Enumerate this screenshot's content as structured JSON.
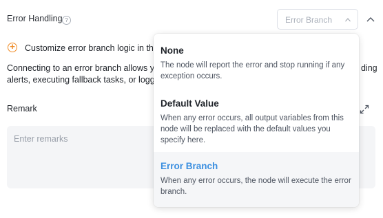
{
  "header": {
    "title": "Error Handling",
    "help_symbol": "?",
    "select_value": "Error Branch"
  },
  "customize": {
    "text": "Customize error branch logic in the"
  },
  "description": {
    "line1": "Connecting to an error branch allows yo",
    "line2": "alerts, executing fallback tasks, or loggi",
    "right_fragment": "ding"
  },
  "remark": {
    "label": "Remark",
    "placeholder": "Enter remarks"
  },
  "dropdown": {
    "options": [
      {
        "title": "None",
        "description": "The node will report the error and stop running if any exception occurs."
      },
      {
        "title": "Default Value",
        "description": "When any error occurs, all output variables from this node will be replaced with the default values you specify here."
      },
      {
        "title": "Error Branch",
        "description": "When any error occurs, the node will execute the error branch.",
        "selected": true
      }
    ]
  },
  "colors": {
    "accent_orange": "#f08a24",
    "selected_blue": "#3b8fe0"
  }
}
